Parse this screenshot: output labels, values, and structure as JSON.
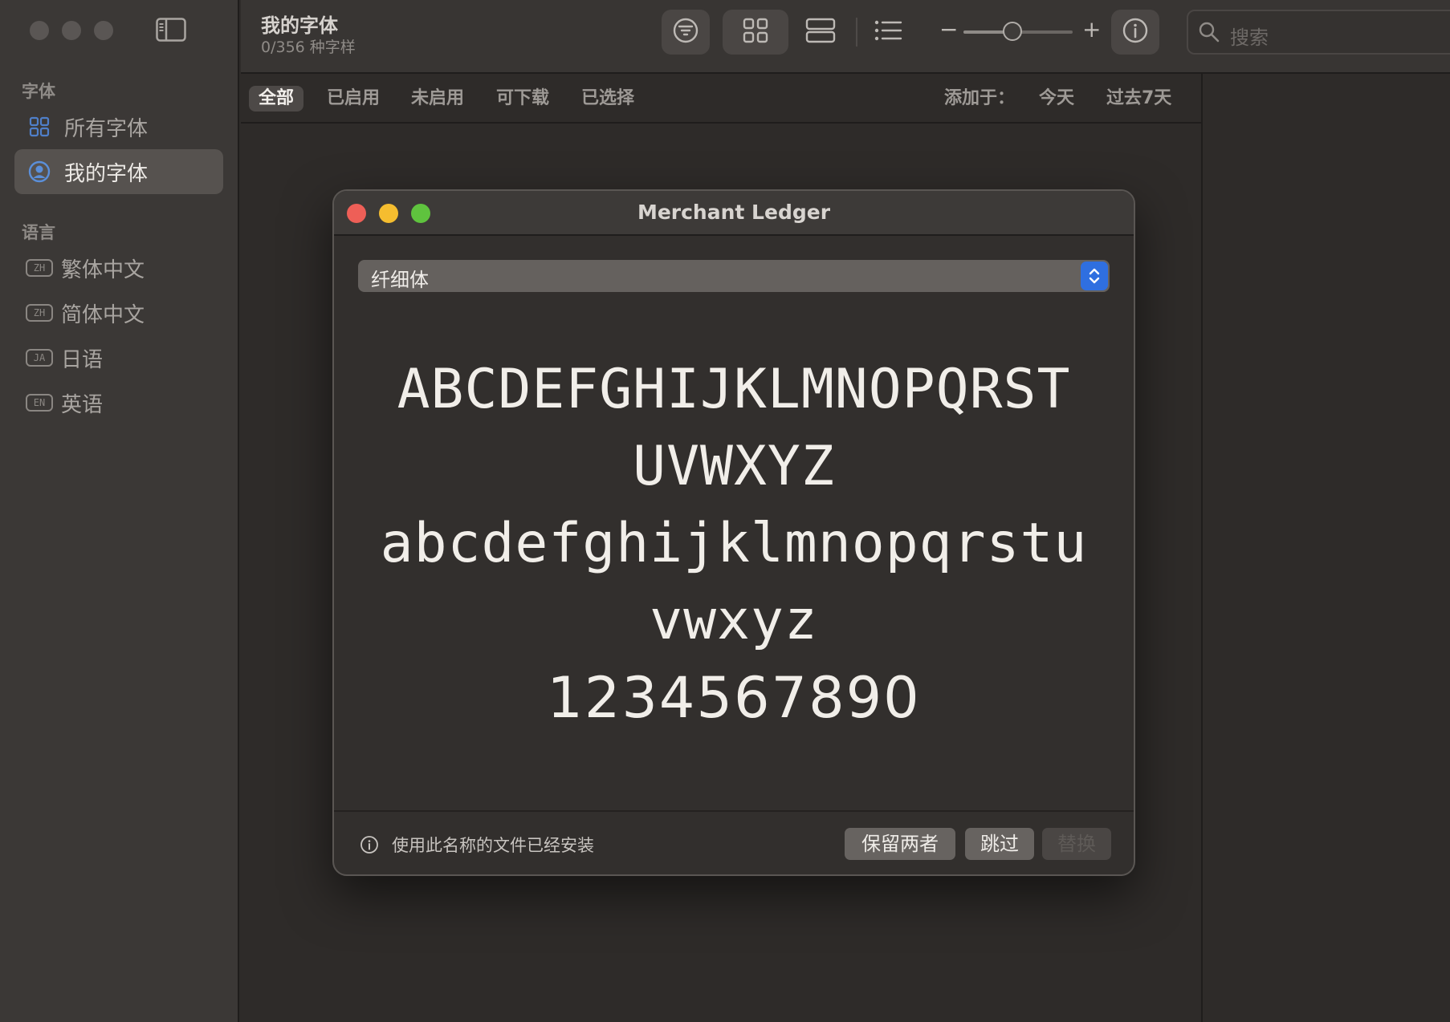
{
  "sidebar": {
    "section_fonts": "字体",
    "items": [
      {
        "label": "所有字体"
      },
      {
        "label": "我的字体"
      }
    ],
    "section_languages": "语言",
    "languages": [
      {
        "badge": "ZH",
        "label": "繁体中文"
      },
      {
        "badge": "ZH",
        "label": "简体中文"
      },
      {
        "badge": "JA",
        "label": "日语"
      },
      {
        "badge": "EN",
        "label": "英语"
      }
    ]
  },
  "toolbar": {
    "title": "我的字体",
    "subtitle": "0/356 种字样",
    "zoom_minus": "−",
    "zoom_plus": "+",
    "zoom_level": 0.45,
    "search_placeholder": "搜索"
  },
  "filters": {
    "tabs": [
      "全部",
      "已启用",
      "未启用",
      "可下载",
      "已选择"
    ],
    "active_index": 0,
    "added_label": "添加于：",
    "added_options": [
      "今天",
      "过去7天"
    ]
  },
  "dialog": {
    "title": "Merchant Ledger",
    "style_value": "纤细体",
    "preview": {
      "upper_1": "ABCDEFGHIJKLMNOPQRST",
      "upper_2": "UVWXYZ",
      "lower_1": "abcdefghijklmnopqrstu",
      "lower_2": "vwxyz",
      "digits": "1234567890"
    },
    "info_text": "使用此名称的文件已经安装",
    "buttons": {
      "keep_both": "保留两者",
      "skip": "跳过",
      "replace": "替换"
    }
  },
  "colors": {
    "accent": "#2f6fe0",
    "close": "#ee5f57",
    "minimize": "#f5bd2f",
    "zoom": "#5fc33e"
  }
}
